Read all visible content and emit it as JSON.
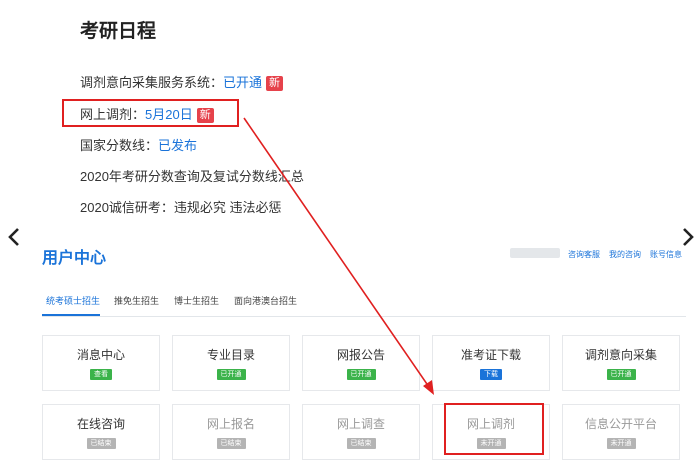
{
  "schedule": {
    "title": "考研日程",
    "items": [
      {
        "label": "调剂意向采集服务系统：",
        "value": "已开通",
        "badge": "新"
      },
      {
        "label": "网上调剂：",
        "value": "5月20日",
        "badge": "新"
      },
      {
        "label": "国家分数线：",
        "value": "已发布"
      },
      {
        "label": "2020年考研分数查询及复试分数线汇总"
      },
      {
        "label": "2020诚信研考：违规必究 违法必惩"
      }
    ]
  },
  "user_center": {
    "title": "用户中心",
    "links": [
      "咨询客服",
      "我的咨询",
      "账号信息"
    ],
    "tabs": [
      "统考硕士招生",
      "推免生招生",
      "博士生招生",
      "面向港澳台招生"
    ],
    "cards": [
      {
        "label": "消息中心",
        "badge": "查看",
        "badge_color": "green"
      },
      {
        "label": "专业目录",
        "badge": "已开通",
        "badge_color": "green"
      },
      {
        "label": "网报公告",
        "badge": "已开通",
        "badge_color": "green"
      },
      {
        "label": "准考证下载",
        "badge": "下载",
        "badge_color": "blue"
      },
      {
        "label": "调剂意向采集",
        "badge": "已开通",
        "badge_color": "green"
      },
      {
        "label": "在线咨询",
        "badge": "已结束",
        "badge_color": "gray"
      },
      {
        "label": "网上报名",
        "badge": "已结束",
        "badge_color": "gray"
      },
      {
        "label": "网上调查",
        "badge": "已结束",
        "badge_color": "gray"
      },
      {
        "label": "网上调剂",
        "badge": "未开通",
        "badge_color": "gray"
      },
      {
        "label": "信息公开平台",
        "badge": "未开通",
        "badge_color": "gray"
      }
    ]
  },
  "colors": {
    "accent": "#1a73d9",
    "highlight": "#e02020",
    "badge_new": "#e6424b",
    "green": "#3bb34a",
    "gray": "#b4b4b4"
  },
  "icons": {
    "prev": "chevron-left-icon",
    "next": "chevron-right-icon"
  }
}
